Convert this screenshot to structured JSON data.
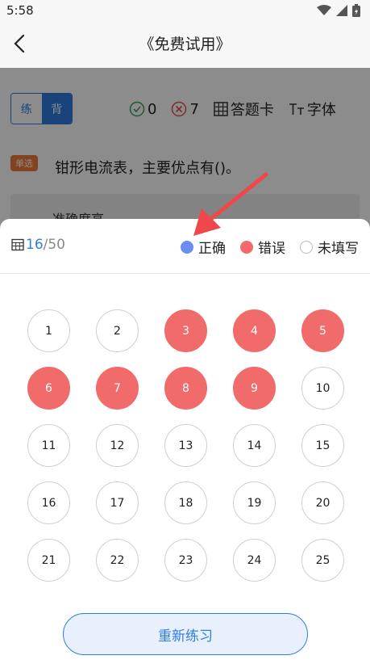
{
  "status_bar": {
    "time": "5:58"
  },
  "nav": {
    "title": "《免费试用》"
  },
  "mode": {
    "practice_label": "练",
    "recite_label": "背"
  },
  "tools": {
    "correct_count": "0",
    "wrong_count": "7",
    "answer_card_label": "答题卡",
    "font_label": "字体"
  },
  "question": {
    "type_badge": "单选",
    "text": "钳形电流表，主要优点有()。",
    "option_partial": "准确度高"
  },
  "sheet": {
    "current": "16",
    "total": "/50",
    "legend": {
      "correct": "正确",
      "wrong": "错误",
      "unanswered": "未填写"
    },
    "questions": [
      {
        "n": "1",
        "status": "unanswered"
      },
      {
        "n": "2",
        "status": "unanswered"
      },
      {
        "n": "3",
        "status": "wrong"
      },
      {
        "n": "4",
        "status": "wrong"
      },
      {
        "n": "5",
        "status": "wrong"
      },
      {
        "n": "6",
        "status": "wrong"
      },
      {
        "n": "7",
        "status": "wrong"
      },
      {
        "n": "8",
        "status": "wrong"
      },
      {
        "n": "9",
        "status": "wrong"
      },
      {
        "n": "10",
        "status": "unanswered"
      },
      {
        "n": "11",
        "status": "unanswered"
      },
      {
        "n": "12",
        "status": "unanswered"
      },
      {
        "n": "13",
        "status": "unanswered"
      },
      {
        "n": "14",
        "status": "unanswered"
      },
      {
        "n": "15",
        "status": "unanswered"
      },
      {
        "n": "16",
        "status": "unanswered"
      },
      {
        "n": "17",
        "status": "unanswered"
      },
      {
        "n": "18",
        "status": "unanswered"
      },
      {
        "n": "19",
        "status": "unanswered"
      },
      {
        "n": "20",
        "status": "unanswered"
      },
      {
        "n": "21",
        "status": "unanswered"
      },
      {
        "n": "22",
        "status": "unanswered"
      },
      {
        "n": "23",
        "status": "unanswered"
      },
      {
        "n": "24",
        "status": "unanswered"
      },
      {
        "n": "25",
        "status": "unanswered"
      }
    ],
    "retry_label": "重新练习"
  },
  "colors": {
    "accent": "#2f7de1",
    "correct": "#6b8ef0",
    "wrong": "#f26b6b",
    "badge": "#ef7a3b",
    "annotation": "#f0484a"
  }
}
